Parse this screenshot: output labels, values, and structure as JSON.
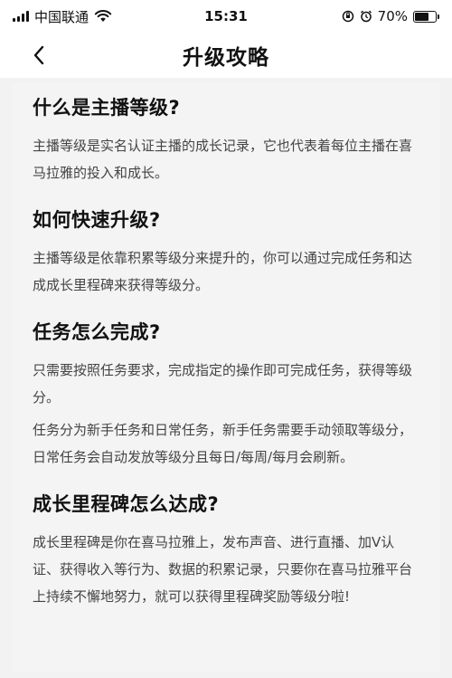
{
  "status_bar": {
    "carrier": "中国联通",
    "time": "15:31",
    "battery_text": "70%",
    "battery_level": 0.7
  },
  "nav": {
    "title": "升级攻略",
    "back_icon": "chevron-left-icon"
  },
  "sections": [
    {
      "heading": "什么是主播等级?",
      "paragraphs": [
        "主播等级是实名认证主播的成长记录，它也代表着每位主播在喜马拉雅的投入和成长。"
      ]
    },
    {
      "heading": "如何快速升级?",
      "paragraphs": [
        "主播等级是依靠积累等级分来提升的，你可以通过完成任务和达成成长里程碑来获得等级分。"
      ]
    },
    {
      "heading": "任务怎么完成?",
      "paragraphs": [
        "只需要按照任务要求，完成指定的操作即可完成任务，获得等级分。",
        "任务分为新手任务和日常任务，新手任务需要手动领取等级分，日常任务会自动发放等级分且每日/每周/每月会刷新。"
      ]
    },
    {
      "heading": "成长里程碑怎么达成?",
      "paragraphs": [
        "成长里程碑是你在喜马拉雅上，发布声音、进行直播、加V认证、获得收入等行为、数据的积累记录，只要你在喜马拉雅平台上持续不懈地努力，就可以获得里程碑奖励等级分啦!"
      ]
    }
  ]
}
